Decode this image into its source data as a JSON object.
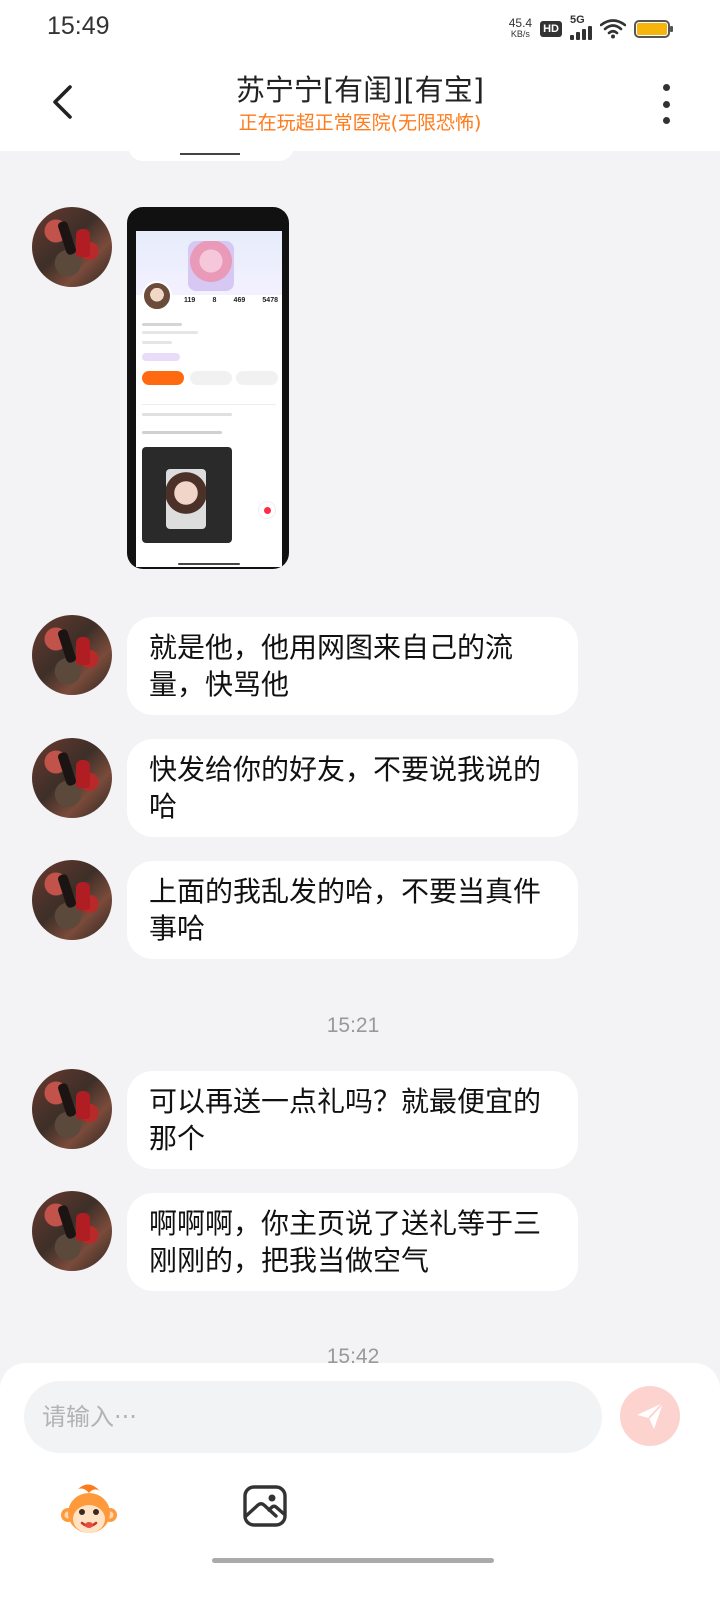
{
  "status_bar": {
    "time": "15:49",
    "net_speed_value": "45.4",
    "net_speed_unit": "KB/s",
    "hd_badge": "HD",
    "network_type": "5G",
    "battery_color": "#f5b50a"
  },
  "header": {
    "title": "苏宁宁[有闺][有宝]",
    "subtitle": "正在玩超正常医院(无限恐怖)",
    "subtitle_color": "#ff7a1a",
    "back_icon": "chevron-left-icon",
    "more_icon": "more-vertical-icon"
  },
  "messages": [
    {
      "type": "image",
      "description_icon": "profile-screenshot"
    },
    {
      "type": "text",
      "text": "就是他，他用网图来自己的流量，快骂他"
    },
    {
      "type": "text",
      "text": "快发给你的好友，不要说我说的哈"
    },
    {
      "type": "text",
      "text": "上面的我乱发的哈，不要当真件事哈"
    },
    {
      "type": "timestamp",
      "text": "15:21"
    },
    {
      "type": "text",
      "text": "可以再送一点礼吗？就最便宜的那个"
    },
    {
      "type": "text",
      "text": "啊啊啊，你主页说了送礼等于三刚刚的，把我当做空气"
    },
    {
      "type": "timestamp",
      "text": "15:42"
    }
  ],
  "screenshot_stats": [
    "119",
    "8",
    "469",
    "5478"
  ],
  "input": {
    "placeholder": "请输入···",
    "value": "",
    "send_icon": "send-icon",
    "send_color": "#fdd3d0"
  },
  "toolbar": {
    "emoji_icon": "monkey-emoji-icon",
    "image_icon": "image-gallery-icon"
  }
}
